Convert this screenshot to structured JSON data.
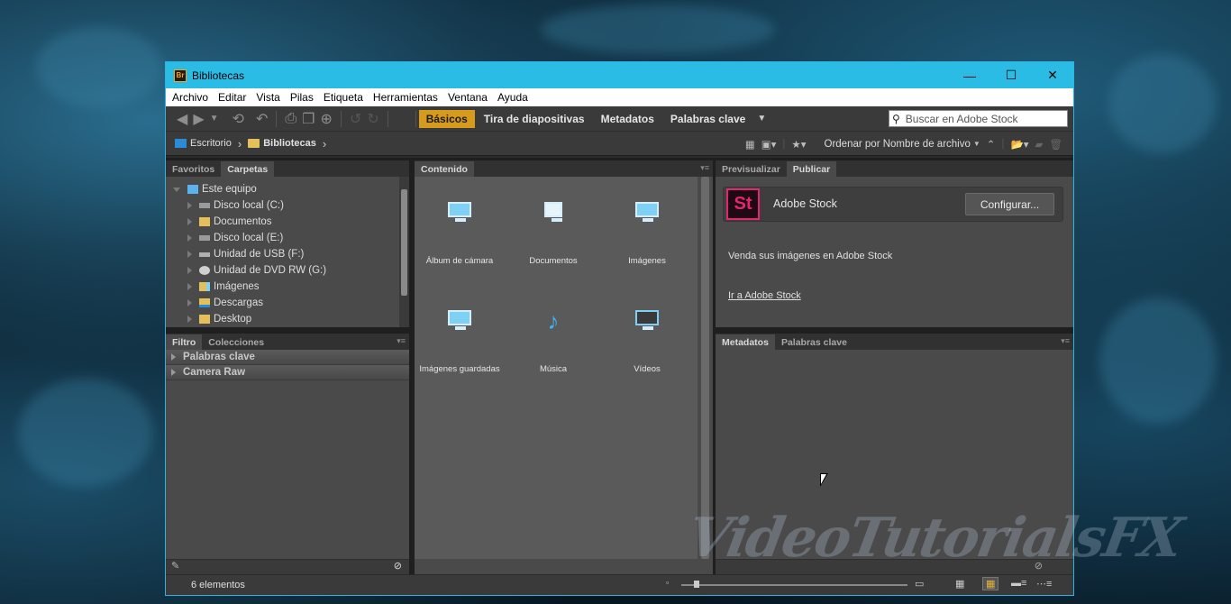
{
  "window": {
    "title": "Bibliotecas",
    "app_badge": "Br"
  },
  "window_controls": {
    "minimize": "—",
    "maximize": "☐",
    "close": "✕"
  },
  "menu": [
    "Archivo",
    "Editar",
    "Vista",
    "Pilas",
    "Etiqueta",
    "Herramientas",
    "Ventana",
    "Ayuda"
  ],
  "workspaces": [
    {
      "label": "Básicos",
      "active": true
    },
    {
      "label": "Tira de diapositivas",
      "active": false
    },
    {
      "label": "Metadatos",
      "active": false
    },
    {
      "label": "Palabras clave",
      "active": false
    }
  ],
  "search": {
    "placeholder": "Buscar en Adobe Stock"
  },
  "breadcrumb": [
    "Escritorio",
    "Bibliotecas"
  ],
  "sort": {
    "label": "Ordenar por Nombre de archivo"
  },
  "left_top_tabs": [
    "Favoritos",
    "Carpetas"
  ],
  "folder_tree": [
    {
      "label": "Este equipo",
      "expanded": true,
      "icon": "computer-icon"
    },
    {
      "label": "Disco local (C:)",
      "icon": "drive-icon"
    },
    {
      "label": "Documentos",
      "icon": "folder-icon"
    },
    {
      "label": "Disco local (E:)",
      "icon": "drive-icon"
    },
    {
      "label": "Unidad de USB (F:)",
      "icon": "usb-icon"
    },
    {
      "label": "Unidad de DVD RW (G:)",
      "icon": "dvd-icon"
    },
    {
      "label": "Imágenes",
      "icon": "pictures-folder-icon"
    },
    {
      "label": "Descargas",
      "icon": "downloads-folder-icon"
    },
    {
      "label": "Desktop",
      "icon": "folder-icon"
    }
  ],
  "left_bottom_tabs": [
    "Filtro",
    "Colecciones"
  ],
  "filter_sections": [
    "Palabras clave",
    "Camera Raw"
  ],
  "content_tab": "Contenido",
  "content_items": [
    {
      "label": "Álbum de cámara",
      "icon": "pictures-library-icon"
    },
    {
      "label": "Documentos",
      "icon": "documents-library-icon"
    },
    {
      "label": "Imágenes",
      "icon": "pictures-library-icon"
    },
    {
      "label": "Imágenes guardadas",
      "icon": "pictures-library-icon"
    },
    {
      "label": "Música",
      "icon": "music-library-icon"
    },
    {
      "label": "Vídeos",
      "icon": "videos-library-icon"
    }
  ],
  "right_top_tabs": [
    "Previsualizar",
    "Publicar"
  ],
  "publish": {
    "logo": "St",
    "service": "Adobe Stock",
    "button": "Configurar...",
    "description": "Venda sus imágenes en Adobe Stock",
    "link": "Ir a Adobe Stock"
  },
  "right_bottom_tabs": [
    "Metadatos",
    "Palabras clave"
  ],
  "status": {
    "count": "6 elementos"
  },
  "colors": {
    "accent": "#d69b1d",
    "titlebar": "#2bbce6",
    "stock": "#e3266f"
  }
}
